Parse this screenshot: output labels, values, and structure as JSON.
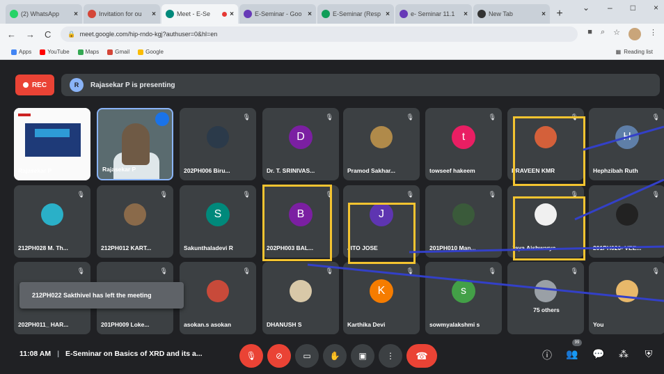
{
  "browser": {
    "tabs": [
      {
        "label": "(2) WhatsApp",
        "icon": "whatsapp-icon",
        "color": "#25d366"
      },
      {
        "label": "Invitation for ou",
        "icon": "gmail-icon",
        "color": "#d44638"
      },
      {
        "label": "Meet - E-Se",
        "icon": "meet-icon",
        "color": "#00897b",
        "active": true
      },
      {
        "label": "E-Seminar - Goo",
        "icon": "forms-icon",
        "color": "#673ab7"
      },
      {
        "label": "E-Seminar (Resp",
        "icon": "sheets-icon",
        "color": "#0f9d58"
      },
      {
        "label": "e- Seminar 11.1",
        "icon": "forms-icon",
        "color": "#673ab7"
      },
      {
        "label": "New Tab",
        "icon": "chrome-icon",
        "color": "#333333"
      }
    ],
    "url": "meet.google.com/hip-rndo-kgj?authuser=0&hl=en",
    "bookmarks": [
      "Apps",
      "YouTube",
      "Maps",
      "Gmail",
      "Google"
    ],
    "reading_list": "Reading list"
  },
  "meet": {
    "rec_label": "REC",
    "presenter_initial": "R",
    "presenting_text": "Rajasekar P is presenting",
    "toast": "212PH022 Sakthivel has left the meeting",
    "time": "11:08 AM",
    "separator": "|",
    "meeting_title": "E-Seminar on Basics of XRD and its a...",
    "participant_count_badge": "99",
    "participants": [
      {
        "name": "Rajasekar P",
        "kind": "slide"
      },
      {
        "name": "Rajasekar P",
        "kind": "camera"
      },
      {
        "name": "202PH006 Biru...",
        "kind": "photo",
        "color": "#2b3a4a"
      },
      {
        "name": "Dr. T. SRINIVAS...",
        "kind": "initial",
        "initial": "D",
        "color": "#7b1fa2"
      },
      {
        "name": "Pramod Sakhar...",
        "kind": "photo",
        "color": "#b08a4a"
      },
      {
        "name": "towseef hakeem",
        "kind": "initial",
        "initial": "t",
        "color": "#e91e63"
      },
      {
        "name": "PRAVEEN KMR",
        "kind": "photo",
        "color": "#d4603a"
      },
      {
        "name": "Hephzibah Ruth",
        "kind": "initial",
        "initial": "H",
        "color": "#5f7fa8"
      },
      {
        "name": "212PH028 M. Th...",
        "kind": "photo",
        "color": "#2ab0c8"
      },
      {
        "name": "212PH012 KART...",
        "kind": "photo",
        "color": "#8a6a4a"
      },
      {
        "name": "Sakunthaladevi R",
        "kind": "initial",
        "initial": "S",
        "color": "#00897b"
      },
      {
        "name": "202PH003 BAL...",
        "kind": "initial",
        "initial": "B",
        "color": "#7b1fa2"
      },
      {
        "name": "JITO JOSE",
        "kind": "initial",
        "initial": "J",
        "color": "#5e35b1"
      },
      {
        "name": "201PH010 Man...",
        "kind": "photo",
        "color": "#3a5a3a"
      },
      {
        "name": "Jaya Aishwarya",
        "kind": "photo",
        "color": "#f0f0f0"
      },
      {
        "name": "201PH020- VEE...",
        "kind": "photo",
        "color": "#222222"
      },
      {
        "name": "202PH011_ HAR...",
        "kind": "hidden"
      },
      {
        "name": "201PH009 Loke...",
        "kind": "hidden"
      },
      {
        "name": "asokan.s asokan",
        "kind": "photo",
        "color": "#c84a3a"
      },
      {
        "name": "DHANUSH S",
        "kind": "photo",
        "color": "#d8c8a8"
      },
      {
        "name": "Karthika Devi",
        "kind": "initial",
        "initial": "K",
        "color": "#f57c00"
      },
      {
        "name": "sowmyalakshmi s",
        "kind": "initial",
        "initial": "s",
        "color": "#43a047"
      },
      {
        "name": "75 others",
        "kind": "others"
      },
      {
        "name": "You",
        "kind": "photo",
        "color": "#e8b86a"
      }
    ]
  }
}
